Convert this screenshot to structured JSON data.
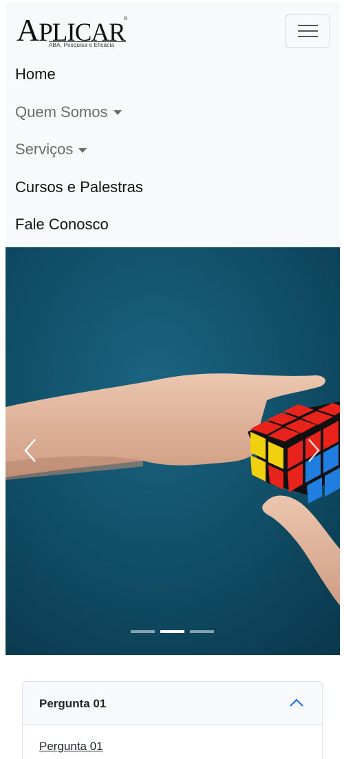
{
  "brand": {
    "name_cap": "A",
    "name_rest": "PLICAR",
    "registered": "®",
    "tagline": "ABA, Pesquisa e Eficácia"
  },
  "nav": {
    "items": [
      {
        "label": "Home",
        "dropdown": false
      },
      {
        "label": "Quem Somos",
        "dropdown": true
      },
      {
        "label": "Serviços",
        "dropdown": true
      },
      {
        "label": "Cursos e Palestras",
        "dropdown": false
      },
      {
        "label": "Fale Conosco",
        "dropdown": false
      }
    ],
    "toggler_icon": "hamburger-icon"
  },
  "carousel": {
    "slide_count": 3,
    "active_index": 1,
    "image_subject": "hand-holding-rubiks-cube",
    "colors": {
      "background": "#0f4a62",
      "skin": "#e0b69c"
    }
  },
  "accordion": {
    "header": "Pergunta 01",
    "body_link": "Pergunta 01",
    "expanded": true,
    "accent": "#0d6efd"
  }
}
